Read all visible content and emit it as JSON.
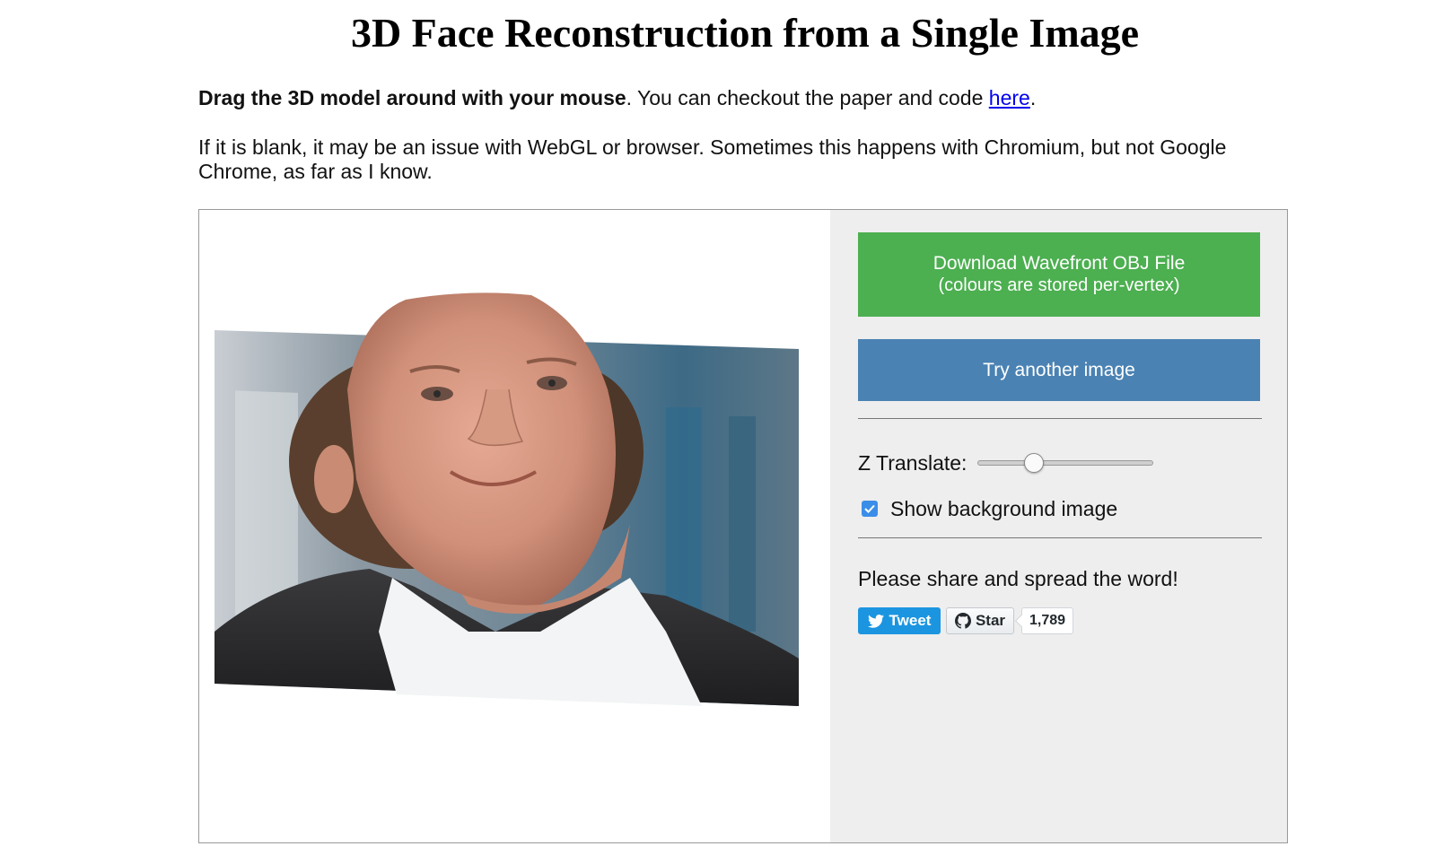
{
  "page": {
    "title": "3D Face Reconstruction from a Single Image"
  },
  "intro": {
    "bold_text": "Drag the 3D model around with your mouse",
    "text_before_link": ". You can checkout the paper and code ",
    "link_text": "here",
    "text_after_link": "."
  },
  "note": {
    "text": "If it is blank, it may be an issue with WebGL or browser. Sometimes this happens with Chromium, but not Google Chrome, as far as I know."
  },
  "viewer": {
    "canvas_icon": "3d-face-render-image"
  },
  "controls": {
    "download_button": {
      "line1": "Download Wavefront OBJ File",
      "line2": "(colours are stored per-vertex)",
      "color": "#4caf50"
    },
    "try_button": {
      "label": "Try another image",
      "color": "#4a82b3"
    },
    "z_translate": {
      "label": "Z Translate:",
      "value_fraction": 0.3
    },
    "background_toggle": {
      "label": "Show background image",
      "checked": true
    },
    "share": {
      "text": "Please share and spread the word!",
      "tweet_label": "Tweet",
      "star_label": "Star",
      "star_count": "1,789"
    }
  }
}
